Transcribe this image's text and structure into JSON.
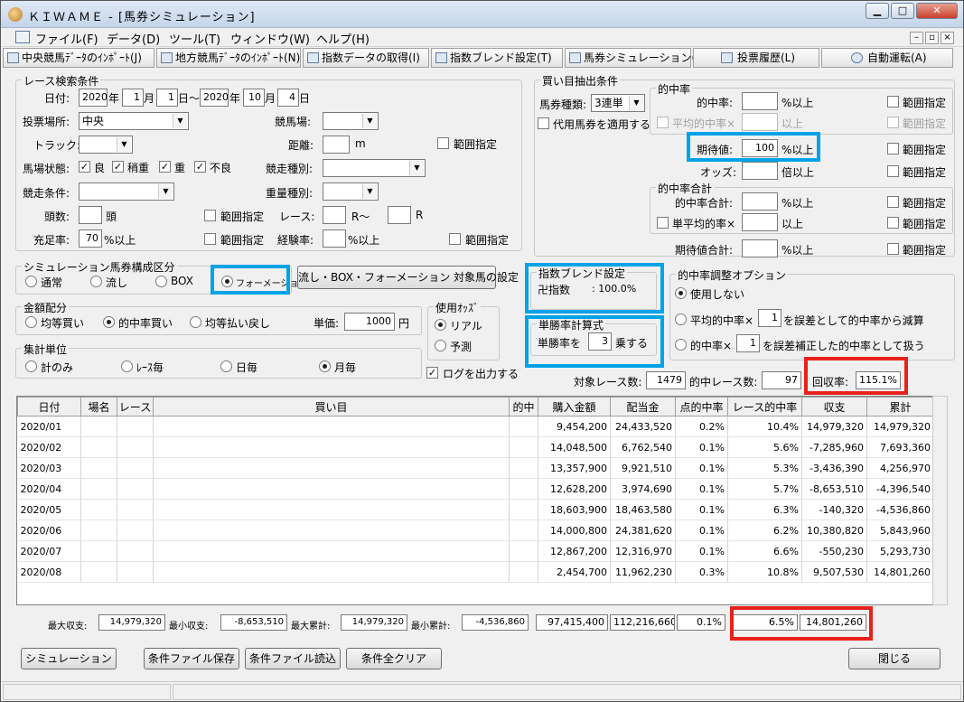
{
  "window": {
    "title": "ＫＩＷＡＭＥ - [馬券シミュレーション]"
  },
  "menu": [
    "ファイル(F)",
    "データ(D)",
    "ツール(T)",
    "ウィンドウ(W)",
    "ヘルプ(H)"
  ],
  "toolbar": [
    "中央競馬ﾃﾞｰﾀのｲﾝﾎﾟｰﾄ(J)",
    "地方競馬ﾃﾞｰﾀのｲﾝﾎﾟｰﾄ(N)",
    "指数データの取得(I)",
    "指数ブレンド設定(T)",
    "馬券シミュレーション(B)",
    "投票履歴(L)",
    "自動運転(A)"
  ],
  "race": {
    "group_title": "レース検索条件",
    "date_label": "日付:",
    "year_unit": "年",
    "month_unit": "月",
    "day_unit": "日",
    "range_sep": "日～",
    "from_year": "2020",
    "from_month": "1",
    "from_day": "1",
    "to_year": "2020",
    "to_month": "10",
    "to_day": "4",
    "venue_label": "投票場所:",
    "venue_value": "中央",
    "track_label": "競馬場:",
    "course_label": "トラック:",
    "distance_label": "距離:",
    "distance_unit": "m",
    "range_label": "範囲指定",
    "condition_label": "馬場状態:",
    "cond_good": "良",
    "cond_slightly": "稍重",
    "cond_heavy": "重",
    "cond_bad": "不良",
    "race_type_label": "競走種別:",
    "race_cond_label": "競走条件:",
    "weight_label": "重量種別:",
    "heads_label": "頭数:",
    "heads_unit": "頭",
    "race_label": "レース:",
    "race_from_unit": "R～",
    "race_to_unit": "R",
    "fill_label": "充足率:",
    "fill_value": "70",
    "fill_unit": "%以上",
    "exp_label": "経験率:",
    "exp_unit": "%以上"
  },
  "sim": {
    "group_title": "シミュレーション馬券構成区分",
    "normal": "通常",
    "nagashi": "流し",
    "box": "BOX",
    "formation": "フォーメーション",
    "target_button": "流し・BOX・フォーメーション 対象馬の設定"
  },
  "money": {
    "group_title": "金額配分",
    "equal_buy": "均等買い",
    "hit_buy": "的中率買い",
    "equal_pay": "均等払い戻し",
    "unit_label": "単価:",
    "unit_value": "1000",
    "unit_suffix": "円"
  },
  "odds": {
    "group_title": "使用ｵｯｽﾞ",
    "real": "リアル",
    "predict": "予測"
  },
  "agg": {
    "group_title": "集計単位",
    "total": "計のみ",
    "race": "ﾚｰｽ毎",
    "day": "日毎",
    "month": "月毎"
  },
  "log_label": "ログを出力する",
  "buy": {
    "group_title": "買い目抽出条件",
    "type_label": "馬券種類:",
    "type_value": "3連単",
    "substitute": "代用馬券を適用する",
    "hit_group": "的中率",
    "hit_label": "的中率:",
    "hit_unit": "%以上",
    "avg_hit_label": "平均的中率×",
    "avg_hit_unit": "以上",
    "ev_label": "期待値:",
    "ev_value": "100",
    "ev_unit": "%以上",
    "odds_label": "オッズ:",
    "odds_unit": "倍以上",
    "sum_group": "的中率合計",
    "hit_sum_label": "的中率合計:",
    "hit_sum_unit": "%以上",
    "single_avg_label": "単平均的率×",
    "single_avg_unit": "以上",
    "ev_sum_label": "期待値合計:",
    "ev_sum_unit": "%以上",
    "range_label": "範囲指定"
  },
  "blend": {
    "group_title": "指数ブレンド設定",
    "name": "卍指数",
    "value": ": 100.0%"
  },
  "win_calc": {
    "group_title": "単勝率計算式",
    "prefix": "単勝率を",
    "value": "3",
    "suffix": "乗する"
  },
  "adjust": {
    "group_title": "的中率調整オプション",
    "none": "使用しない",
    "opt1_prefix": "平均的中率×",
    "opt1_value": "1",
    "opt1_suffix": "を誤差として的中率から減算",
    "opt2_prefix": "的中率×",
    "opt2_value": "1",
    "opt2_suffix": "を誤差補正した的中率として扱う"
  },
  "summary": {
    "target_label": "対象レース数:",
    "target_value": "1479",
    "hit_label": "的中レース数:",
    "hit_value": "97",
    "recovery_label": "回収率:",
    "recovery_value": "115.1%"
  },
  "table": {
    "headers": [
      "日付",
      "場名",
      "レース",
      "買い目",
      "的中",
      "購入金額",
      "配当金",
      "点的中率",
      "レース的中率",
      "収支",
      "累計"
    ],
    "rows": [
      [
        "2020/01",
        "",
        "",
        "",
        "",
        "9,454,200",
        "24,433,520",
        "0.2%",
        "10.4%",
        "14,979,320",
        "14,979,320"
      ],
      [
        "2020/02",
        "",
        "",
        "",
        "",
        "14,048,500",
        "6,762,540",
        "0.1%",
        "5.6%",
        "-7,285,960",
        "7,693,360"
      ],
      [
        "2020/03",
        "",
        "",
        "",
        "",
        "13,357,900",
        "9,921,510",
        "0.1%",
        "5.3%",
        "-3,436,390",
        "4,256,970"
      ],
      [
        "2020/04",
        "",
        "",
        "",
        "",
        "12,628,200",
        "3,974,690",
        "0.1%",
        "5.7%",
        "-8,653,510",
        "-4,396,540"
      ],
      [
        "2020/05",
        "",
        "",
        "",
        "",
        "18,603,900",
        "18,463,580",
        "0.1%",
        "6.3%",
        "-140,320",
        "-4,536,860"
      ],
      [
        "2020/06",
        "",
        "",
        "",
        "",
        "14,000,800",
        "24,381,620",
        "0.1%",
        "6.2%",
        "10,380,820",
        "5,843,960"
      ],
      [
        "2020/07",
        "",
        "",
        "",
        "",
        "12,867,200",
        "12,316,970",
        "0.1%",
        "6.6%",
        "-550,230",
        "5,293,730"
      ],
      [
        "2020/08",
        "",
        "",
        "",
        "",
        "2,454,700",
        "11,962,230",
        "0.3%",
        "10.8%",
        "9,507,530",
        "14,801,260"
      ]
    ]
  },
  "footer": {
    "max_label": "最大収支:",
    "max_value": "14,979,320",
    "min_label": "最小収支:",
    "min_value": "-8,653,510",
    "max_cum_label": "最大累計:",
    "max_cum_value": "14,979,320",
    "min_cum_label": "最小累計:",
    "min_cum_value": "-4,536,860",
    "total_buy": "97,415,400",
    "total_pay": "112,216,660",
    "point_rate": "0.1%",
    "race_rate": "6.5%",
    "total_balance": "14,801,260"
  },
  "buttons": {
    "simulate": "シミュレーション",
    "save": "条件ファイル保存",
    "load": "条件ファイル読込",
    "clear": "条件全クリア",
    "close": "閉じる"
  }
}
